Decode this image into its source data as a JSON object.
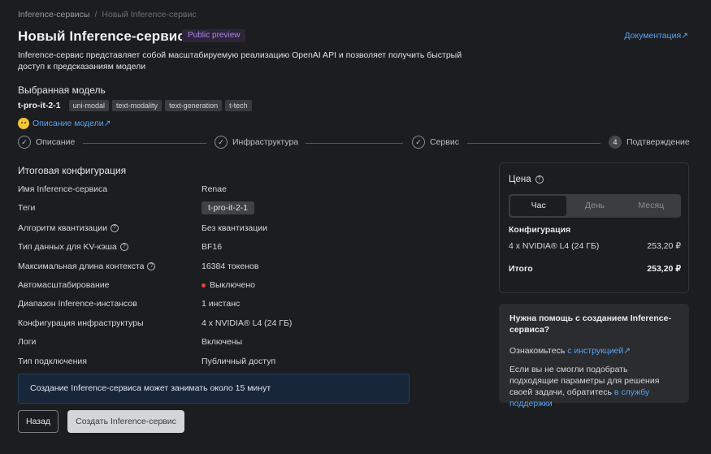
{
  "breadcrumb": {
    "parent": "Inference-сервисы",
    "separator": "/",
    "current": "Новый Inference-сервис"
  },
  "header": {
    "title": "Новый Inference-сервис",
    "badge": "Public preview",
    "docs_link": "Документация",
    "description": "Inference-сервис представляет собой масштабируемую реализацию OpenAI API и позволяет получить быстрый доступ к предсказаниям модели"
  },
  "model": {
    "section_title": "Выбранная модель",
    "name": "t-pro-it-2-1",
    "tags": [
      "uni-modal",
      "text-modality",
      "text-generation",
      "t-tech"
    ],
    "description_link": "Описание модели"
  },
  "stepper": {
    "steps": [
      {
        "label": "Описание",
        "state": "done"
      },
      {
        "label": "Инфраструктура",
        "state": "done"
      },
      {
        "label": "Сервис",
        "state": "done"
      },
      {
        "label": "Подтверждение",
        "state": "active",
        "number": "4"
      }
    ]
  },
  "config": {
    "title": "Итоговая конфигурация",
    "rows": [
      {
        "label": "Имя Inference-сервиса",
        "value": "Renae"
      },
      {
        "label": "Теги",
        "value": "t-pro-it-2-1"
      },
      {
        "label": "Алгоритм квантизации",
        "value": "Без квантизации"
      },
      {
        "label": "Тип данных для KV-кэша",
        "value": "BF16"
      },
      {
        "label": "Максимальная длина контекста",
        "value": "16384 токенов"
      },
      {
        "label": "Автомасштабирование",
        "value": "Выключено"
      },
      {
        "label": "Диапазон Inference-инстансов",
        "value": "1 инстанс"
      },
      {
        "label": "Конфигурация инфраструктуры",
        "value": "4 x NVIDIA® L4 (24 ГБ)"
      },
      {
        "label": "Логи",
        "value": "Включены"
      },
      {
        "label": "Тип подключения",
        "value": "Публичный доступ"
      }
    ]
  },
  "banner": {
    "text": "Создание Inference-сервиса может занимать около 15 минут"
  },
  "actions": {
    "back": "Назад",
    "create": "Создать Inference-сервис"
  },
  "price": {
    "title": "Цена",
    "tabs": [
      "Час",
      "День",
      "Месяц"
    ],
    "active_tab": "Час",
    "config_title": "Конфигурация",
    "config_item": "4 x NVIDIA® L4 (24 ГБ)",
    "config_price": "253,20 ₽",
    "total_label": "Итого",
    "total_price": "253,20 ₽"
  },
  "help": {
    "title": "Нужна помощь с созданием Inference-сервиса?",
    "line1_prefix": "Ознакомьтесь",
    "line1_link": "с инструкцией",
    "line2_prefix": "Если вы не смогли подобрать подходящие параметры для решения своей задачи, обратитесь",
    "line2_link": "в службу поддержки"
  },
  "colors": {
    "accent_link": "#5aa3f0",
    "badge_text": "#a987e6",
    "status_off": "#e2453c"
  }
}
